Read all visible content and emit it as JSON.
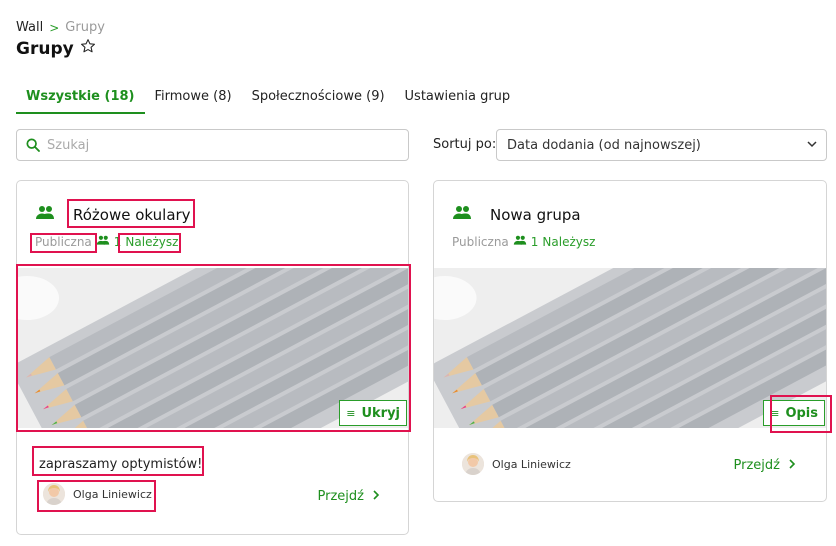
{
  "breadcrumb": {
    "root": "Wall",
    "separator": ">",
    "current": "Grupy"
  },
  "page": {
    "title": "Grupy",
    "star_icon": "star-outline-icon"
  },
  "tabs": [
    {
      "label": "Wszystkie (18)",
      "active": true
    },
    {
      "label": "Firmowe (8)",
      "active": false
    },
    {
      "label": "Społecznościowe (9)",
      "active": false
    },
    {
      "label": "Ustawienia grup",
      "active": false
    }
  ],
  "search": {
    "placeholder": "Szukaj",
    "value": ""
  },
  "sort": {
    "label": "Sortuj po:",
    "selected": "Data dodania (od najnowszej)"
  },
  "groups": [
    {
      "title": "Różowe okulary",
      "visibility": "Publiczna",
      "members_count": "1",
      "membership": "Należysz",
      "toggle_label": "Ukryj",
      "description": "zapraszamy optymistów!",
      "author": "Olga Liniewicz",
      "link": "Przejdź"
    },
    {
      "title": "Nowa grupa",
      "visibility": "Publiczna",
      "members_count": "1",
      "membership": "Należysz",
      "toggle_label": "Opis",
      "author": "Olga Liniewicz",
      "link": "Przejdź"
    }
  ],
  "colors": {
    "accent": "#1e8f1e",
    "highlight": "#e0124f",
    "muted": "#9a9a9a"
  }
}
